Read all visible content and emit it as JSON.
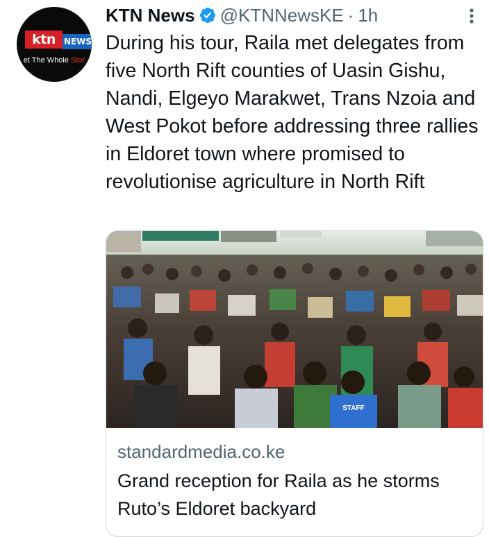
{
  "tweet": {
    "author": {
      "name": "KTN News",
      "handle": "@KTNNewsKE",
      "separator": "·",
      "time": "1h",
      "verified": true
    },
    "avatar": {
      "logo_main": "ktn",
      "logo_badge": "NEWS",
      "tagline_white": "et The Whole ",
      "tagline_red": "Stor"
    },
    "text": "During his tour, Raila met delegates from five North Rift counties of Uasin Gishu, Nandi, Elgeyo Marakwet, Trans Nzoia and West Pokot before addressing three rallies in Eldoret town where promised to revolutionise agriculture in North Rift",
    "card": {
      "image_label": "STAFF",
      "domain": "standardmedia.co.ke",
      "title": "Grand reception for Raila as he storms Ruto’s Eldoret backyard"
    },
    "colors": {
      "verified": "#1d9bf0",
      "secondary_text": "#536471",
      "primary_text": "#0f1419",
      "ktn_red": "#d71f26",
      "news_blue": "#1565c0"
    },
    "icons": [
      "verified-badge-icon",
      "more-options-icon"
    ]
  }
}
